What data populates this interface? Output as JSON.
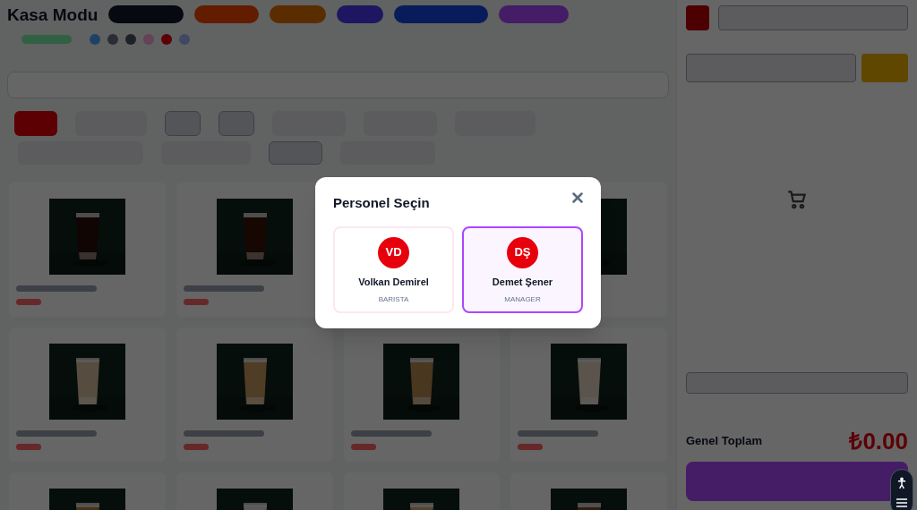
{
  "background": {
    "title": "Kasa Modu",
    "grand_total_label": "Genel Toplam",
    "grand_total": "₺0.00"
  },
  "modal": {
    "title": "Personel Seçin",
    "staff": [
      {
        "initials": "VD",
        "name": "Volkan Demirel",
        "role": "BARISTA",
        "selected": false
      },
      {
        "initials": "DŞ",
        "name": "Demet Şener",
        "role": "MANAGER",
        "selected": true
      }
    ]
  }
}
